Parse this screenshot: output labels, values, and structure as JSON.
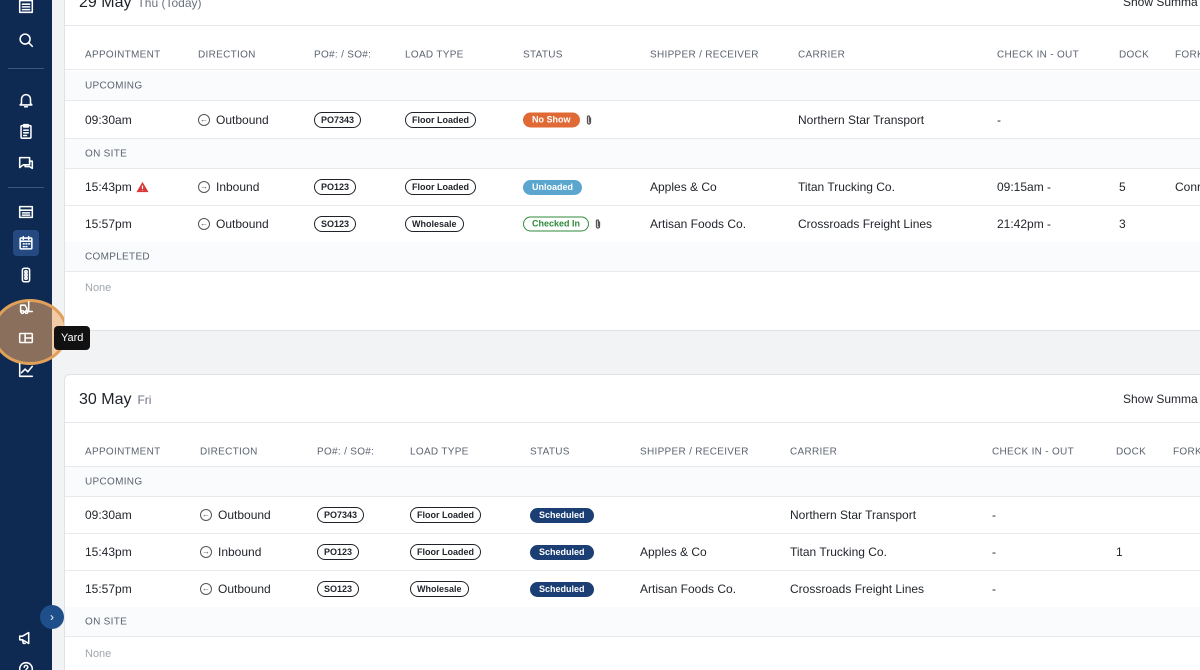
{
  "sidebar": {
    "icons": [
      "warehouse-icon",
      "search-icon",
      "bell-icon",
      "clipboard-icon",
      "chat-icon",
      "list-icon",
      "calendar-icon",
      "traffic-light-icon",
      "forklift-icon",
      "yard-icon",
      "chart-icon",
      "megaphone-icon",
      "help-icon"
    ],
    "tooltip": "Yard",
    "colors": {
      "bg": "#0e2a52",
      "highlight": "#e0a05a"
    }
  },
  "columns": [
    "APPOINTMENT",
    "DIRECTION",
    "PO#: / SO#:",
    "LOAD TYPE",
    "STATUS",
    "SHIPPER / RECEIVER",
    "CARRIER",
    "CHECK IN - OUT",
    "DOCK",
    "FORK"
  ],
  "day1": {
    "date": "29 May",
    "weekday": "Thu (Today)",
    "show_summary": "Show Summa",
    "sections": {
      "upcoming": "UPCOMING",
      "on_site": "ON SITE",
      "completed": "COMPLETED"
    },
    "upcoming": [
      {
        "time": "09:30am",
        "direction": "Outbound",
        "po": "PO7343",
        "load": "Floor Loaded",
        "status": "No Show",
        "shipper": "",
        "carrier": "Northern Star Transport",
        "check": "-",
        "dock": "",
        "fork": ""
      }
    ],
    "on_site": [
      {
        "time": "15:43pm",
        "direction": "Inbound",
        "po": "PO123",
        "load": "Floor Loaded",
        "status": "Unloaded",
        "shipper": "Apples & Co",
        "carrier": "Titan Trucking Co.",
        "check": "09:15am -",
        "dock": "5",
        "fork": "Conr"
      },
      {
        "time": "15:57pm",
        "direction": "Outbound",
        "po": "SO123",
        "load": "Wholesale",
        "status": "Checked In",
        "shipper": "Artisan Foods Co.",
        "carrier": "Crossroads Freight Lines",
        "check": "21:42pm -",
        "dock": "3",
        "fork": ""
      }
    ],
    "completed_none": "None"
  },
  "day2": {
    "date": "30 May",
    "weekday": "Fri",
    "show_summary": "Show Summa",
    "sections": {
      "upcoming": "UPCOMING",
      "on_site": "ON SITE"
    },
    "upcoming": [
      {
        "time": "09:30am",
        "direction": "Outbound",
        "po": "PO7343",
        "load": "Floor Loaded",
        "status": "Scheduled",
        "shipper": "",
        "carrier": "Northern Star Transport",
        "check": "-",
        "dock": "",
        "fork": ""
      },
      {
        "time": "15:43pm",
        "direction": "Inbound",
        "po": "PO123",
        "load": "Floor Loaded",
        "status": "Scheduled",
        "shipper": "Apples & Co",
        "carrier": "Titan Trucking Co.",
        "check": "-",
        "dock": "1",
        "fork": ""
      },
      {
        "time": "15:57pm",
        "direction": "Outbound",
        "po": "SO123",
        "load": "Wholesale",
        "status": "Scheduled",
        "shipper": "Artisan Foods Co.",
        "carrier": "Crossroads Freight Lines",
        "check": "-",
        "dock": "",
        "fork": ""
      }
    ],
    "on_site_none": "None"
  }
}
